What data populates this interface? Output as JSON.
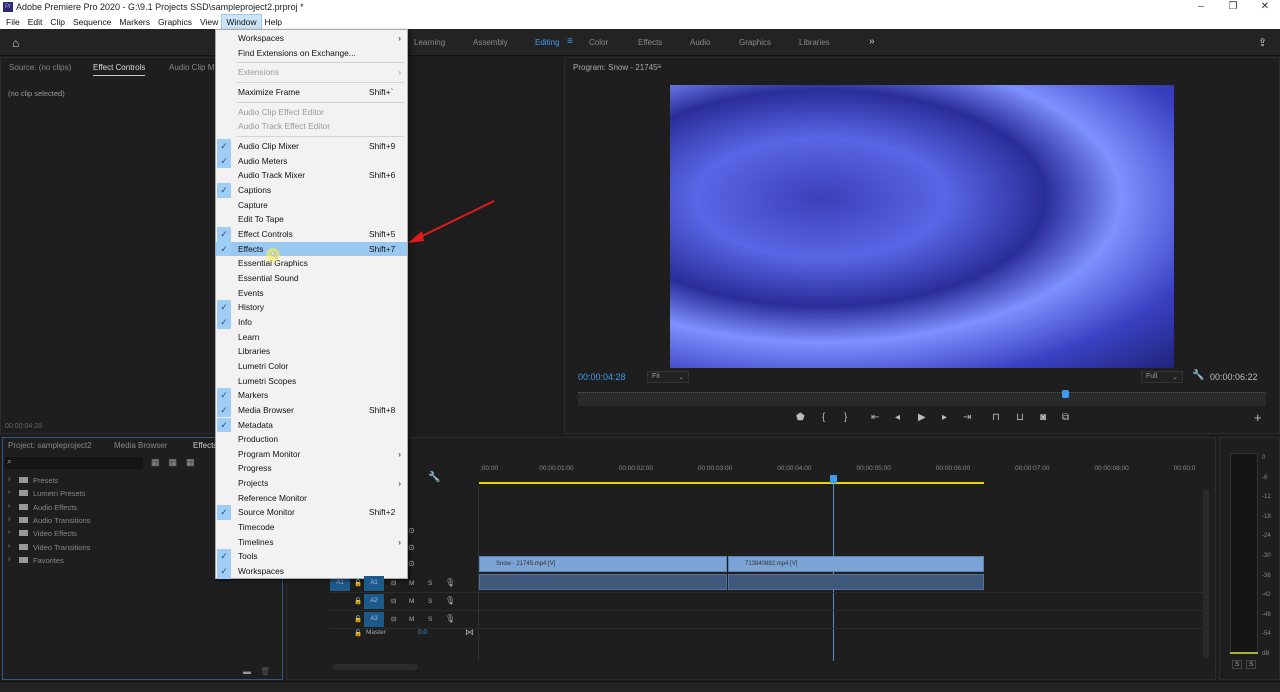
{
  "window": {
    "title": "Adobe Premiere Pro 2020 - G:\\9.1 Projects SSD\\sampleproject2.prproj *",
    "logo": "Pr"
  },
  "menubar": [
    "File",
    "Edit",
    "Clip",
    "Sequence",
    "Markers",
    "Graphics",
    "View",
    "Window",
    "Help"
  ],
  "workspaces": [
    "Learning",
    "Assembly",
    "Editing",
    "Color",
    "Effects",
    "Audio",
    "Graphics",
    "Libraries"
  ],
  "more_workspaces": "»",
  "source_panel": {
    "tabs": [
      "Source: (no clips)",
      "Effect Controls",
      "Audio Clip Mi"
    ],
    "content": "(no clip selected)",
    "timecode": "00:00:04:28"
  },
  "project_panel": {
    "tabs": [
      "Project: sampleproject2",
      "Media Browser",
      "Effects"
    ],
    "search_placeholder": "",
    "folders": [
      "Presets",
      "Lumetri Presets",
      "Audio Effects",
      "Audio Transitions",
      "Video Effects",
      "Video Transitions",
      "Favorites"
    ]
  },
  "program_monitor": {
    "title": "Program: Snow - 21745",
    "timecode": "00:00:04:28",
    "fit": "Fit",
    "quality": "Full",
    "duration": "00:00:06:22",
    "playhead_fraction": 0.71
  },
  "window_menu": {
    "items": [
      {
        "label": "Workspaces",
        "submenu": true
      },
      {
        "label": "Find Extensions on Exchange..."
      },
      {
        "sep": true
      },
      {
        "label": "Extensions",
        "submenu": true,
        "disabled": true
      },
      {
        "sep": true
      },
      {
        "label": "Maximize Frame",
        "shortcut": "Shift+`"
      },
      {
        "sep": true
      },
      {
        "label": "Audio Clip Effect Editor",
        "disabled": true
      },
      {
        "label": "Audio Track Effect Editor",
        "disabled": true
      },
      {
        "sep": true
      },
      {
        "label": "Audio Clip Mixer",
        "checked": true,
        "shortcut": "Shift+9"
      },
      {
        "label": "Audio Meters",
        "checked": true
      },
      {
        "label": "Audio Track Mixer",
        "shortcut": "Shift+6"
      },
      {
        "label": "Captions",
        "checked": true
      },
      {
        "label": "Capture"
      },
      {
        "label": "Edit To Tape"
      },
      {
        "label": "Effect Controls",
        "checked": true,
        "shortcut": "Shift+5"
      },
      {
        "label": "Effects",
        "checked": true,
        "shortcut": "Shift+7",
        "highlighted": true
      },
      {
        "label": "Essential Graphics"
      },
      {
        "label": "Essential Sound"
      },
      {
        "label": "Events"
      },
      {
        "label": "History",
        "checked": true
      },
      {
        "label": "Info",
        "checked": true
      },
      {
        "label": "Learn"
      },
      {
        "label": "Libraries"
      },
      {
        "label": "Lumetri Color"
      },
      {
        "label": "Lumetri Scopes"
      },
      {
        "label": "Markers",
        "checked": true
      },
      {
        "label": "Media Browser",
        "checked": true,
        "shortcut": "Shift+8"
      },
      {
        "label": "Metadata",
        "checked": true
      },
      {
        "label": "Production"
      },
      {
        "label": "Program Monitor",
        "submenu": true
      },
      {
        "label": "Progress"
      },
      {
        "label": "Projects",
        "submenu": true
      },
      {
        "label": "Reference Monitor"
      },
      {
        "label": "Source Monitor",
        "checked": true,
        "shortcut": "Shift+2"
      },
      {
        "label": "Timecode"
      },
      {
        "label": "Timelines",
        "submenu": true
      },
      {
        "label": "Tools",
        "checked": true
      },
      {
        "label": "Workspaces",
        "checked": true
      }
    ]
  },
  "timeline": {
    "ruler": [
      ":00:00",
      "00:00:01:00",
      "00:00:02:00",
      "00:00:03:00",
      "00:00:04:00",
      "00:00:05:00",
      "00:00:06:00",
      "00:00:07:00",
      "00:00:08:00",
      "00:00:0"
    ],
    "clips": [
      "Snow - 21745.mp4 [V]",
      "713840882.mp4 [V]"
    ],
    "audio_tracks": [
      "A1",
      "A2",
      "A3"
    ],
    "source_patch": "A1",
    "master_label": "Master",
    "master_value": "0.0",
    "track_buttons": {
      "mute": "M",
      "solo": "S"
    }
  },
  "meters": {
    "scale": [
      "0",
      "-6",
      "-12",
      "-18",
      "-24",
      "-30",
      "-36",
      "-42",
      "-48",
      "-54",
      "dB"
    ],
    "solo": [
      "S",
      "S"
    ]
  },
  "accent": "#3e9bf2"
}
